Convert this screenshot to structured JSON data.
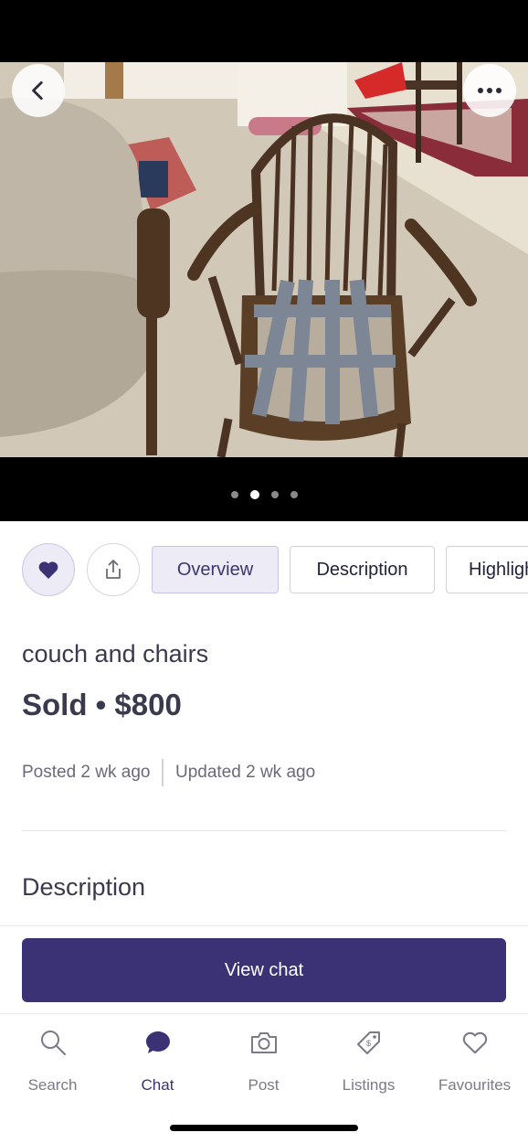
{
  "photo": {
    "alt": "Wooden spindle-back chair next to an upholstered chair",
    "carousel": {
      "count": 4,
      "active_index": 1
    }
  },
  "header": {
    "back_icon": "chevron-left-icon",
    "more_icon": "more-horizontal-icon"
  },
  "actions": {
    "favourite_icon": "heart-icon",
    "share_icon": "share-icon"
  },
  "tabs": [
    {
      "label": "Overview",
      "active": true
    },
    {
      "label": "Description",
      "active": false
    },
    {
      "label": "Highlights",
      "active": false
    }
  ],
  "listing": {
    "title": "couch and chairs",
    "price_line": "Sold • $800",
    "posted": "Posted 2 wk ago",
    "updated": "Updated 2 wk ago",
    "description_heading": "Description"
  },
  "cta": {
    "label": "View chat"
  },
  "bottom_nav": [
    {
      "label": "Search",
      "icon": "search-icon",
      "active": false
    },
    {
      "label": "Chat",
      "icon": "chat-bubble-icon",
      "active": true
    },
    {
      "label": "Post",
      "icon": "camera-icon",
      "active": false
    },
    {
      "label": "Listings",
      "icon": "price-tag-icon",
      "active": false
    },
    {
      "label": "Favourites",
      "icon": "heart-outline-icon",
      "active": false
    }
  ],
  "colors": {
    "brand": "#3a3275",
    "tab_active_bg": "#ecebf6",
    "text": "#3a3a4e",
    "muted": "#7a7a88"
  }
}
